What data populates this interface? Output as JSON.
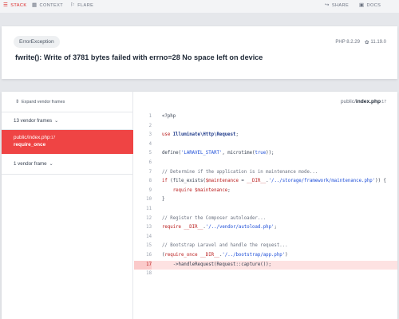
{
  "nav": {
    "items": [
      {
        "icon": "stack-icon",
        "label": "STACK",
        "active": true
      },
      {
        "icon": "context-icon",
        "label": "CONTEXT",
        "active": false
      },
      {
        "icon": "flare-icon",
        "label": "FLARE",
        "active": false
      },
      {
        "icon": "share-icon",
        "label": "SHARE",
        "active": false
      },
      {
        "icon": "docs-icon",
        "label": "DOCS",
        "active": false
      }
    ]
  },
  "error": {
    "exception": "ErrorException",
    "php_version": "PHP 8.2.29",
    "laravel_version": "11.19.0",
    "message": "fwrite(): Write of 3781 bytes failed with errno=28 No space left on device"
  },
  "frames": {
    "expand_label": "Expand vendor frames",
    "vendor_group_top": "13 vendor frames",
    "active_frame": {
      "path": "public/index.php",
      "line": ":17",
      "method": "require_once"
    },
    "vendor_group_bottom": "1 vendor frame"
  },
  "code_view": {
    "file_path": "public/",
    "file_name": "index.php",
    "line": ":17",
    "highlight_line": 17,
    "lines": [
      {
        "n": "1",
        "tokens": [
          [
            "plain",
            "<?php"
          ]
        ]
      },
      {
        "n": "2",
        "tokens": []
      },
      {
        "n": "3",
        "tokens": [
          [
            "kw",
            "use "
          ],
          [
            "cls",
            "Illuminate\\Http\\Request"
          ],
          [
            "plain",
            ";"
          ]
        ]
      },
      {
        "n": "4",
        "tokens": []
      },
      {
        "n": "5",
        "tokens": [
          [
            "plain",
            "define("
          ],
          [
            "str",
            "'LARAVEL_START'"
          ],
          [
            "plain",
            ", microtime("
          ],
          [
            "str",
            "true"
          ],
          [
            "plain",
            "));"
          ]
        ]
      },
      {
        "n": "6",
        "tokens": []
      },
      {
        "n": "7",
        "tokens": [
          [
            "cmt",
            "// Determine if the application is in maintenance mode..."
          ]
        ]
      },
      {
        "n": "8",
        "tokens": [
          [
            "kw",
            "if "
          ],
          [
            "plain",
            "(file_exists("
          ],
          [
            "var",
            "$maintenance"
          ],
          [
            "plain",
            " = "
          ],
          [
            "kw",
            "__DIR__"
          ],
          [
            "plain",
            "."
          ],
          [
            "str",
            "'/../storage/framework/maintenance.php'"
          ],
          [
            "plain",
            ")) {"
          ]
        ]
      },
      {
        "n": "9",
        "tokens": [
          [
            "plain",
            "    "
          ],
          [
            "kw",
            "require "
          ],
          [
            "var",
            "$maintenance"
          ],
          [
            "plain",
            ";"
          ]
        ]
      },
      {
        "n": "10",
        "tokens": [
          [
            "plain",
            "}"
          ]
        ]
      },
      {
        "n": "11",
        "tokens": []
      },
      {
        "n": "12",
        "tokens": [
          [
            "cmt",
            "// Register the Composer autoloader..."
          ]
        ]
      },
      {
        "n": "13",
        "tokens": [
          [
            "kw",
            "require "
          ],
          [
            "kw",
            "__DIR__"
          ],
          [
            "plain",
            "."
          ],
          [
            "str",
            "'/../vendor/autoload.php'"
          ],
          [
            "plain",
            ";"
          ]
        ]
      },
      {
        "n": "14",
        "tokens": []
      },
      {
        "n": "15",
        "tokens": [
          [
            "cmt",
            "// Bootstrap Laravel and handle the request..."
          ]
        ]
      },
      {
        "n": "16",
        "tokens": [
          [
            "plain",
            "("
          ],
          [
            "kw",
            "require_once "
          ],
          [
            "kw",
            "__DIR__"
          ],
          [
            "plain",
            "."
          ],
          [
            "str",
            "'/../bootstrap/app.php'"
          ],
          [
            "plain",
            ")"
          ]
        ]
      },
      {
        "n": "17",
        "tokens": [
          [
            "plain",
            "    ->handleRequest(Request::capture());"
          ]
        ]
      },
      {
        "n": "18",
        "tokens": []
      }
    ]
  },
  "colors": {
    "accent": "#ef4444",
    "active_nav": "#dc2626",
    "highlight_bg": "#fde2e2"
  }
}
